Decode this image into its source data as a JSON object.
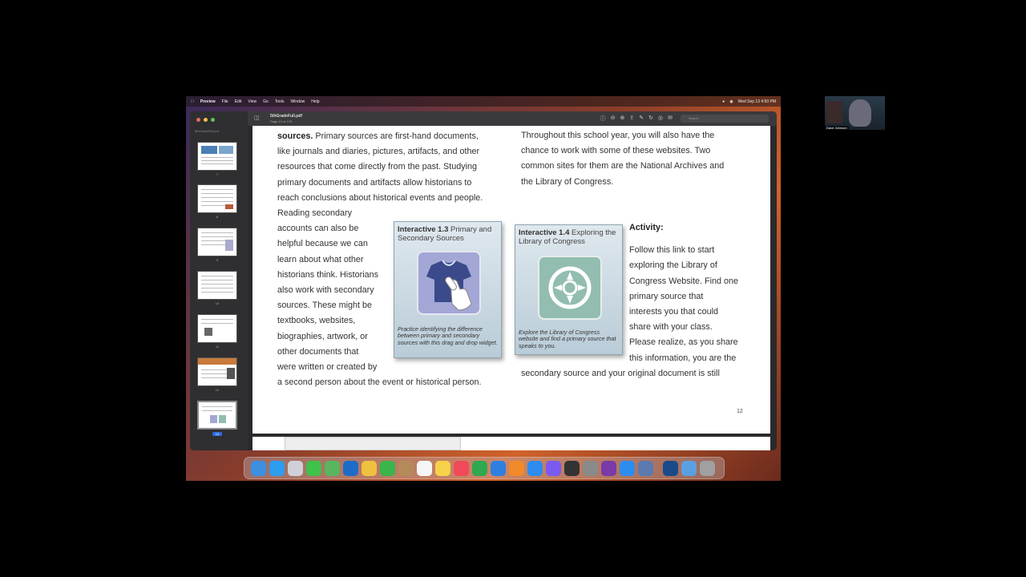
{
  "menubar": {
    "apple": "",
    "items": [
      "Preview",
      "File",
      "Edit",
      "View",
      "Go",
      "Tools",
      "Window",
      "Help"
    ],
    "clock": "Wed Sep 13  4:50 PM"
  },
  "sidebar": {
    "filename": "5thGradeFull.pdf",
    "thumbs": [
      "7",
      "8",
      "9",
      "10",
      "11",
      "12",
      "13"
    ]
  },
  "toolbar": {
    "doc_title": "5thGradeFull.pdf",
    "page_info": "Page 13 of 178",
    "search_placeholder": "Search"
  },
  "page": {
    "left_lines": [
      "sources.",
      "like journals and diaries,  pictures, artifacts, and other",
      "resources that come directly from the past.  Studying",
      "primary documents and artifacts allow historians to",
      "reach conclusions about historical events and people.",
      "Reading secondary",
      "accounts can also be",
      "helpful because we can",
      "learn about what other",
      "historians think.  Historians",
      "also work with secondary",
      "sources.  These might be",
      "textbooks, websites,",
      "biographies, artwork, or",
      "other  documents that",
      "were written or created by",
      "a second person about the event or historical person."
    ],
    "first_line_rest": "  Primary sources are first-hand documents,",
    "right_lines": [
      "Throughout this school year, you will also have the",
      "chance to work with some of these websites.  Two",
      "common sites for them are the National Archives and",
      "the Library of Congress."
    ],
    "activity_title": "Activity:",
    "activity_lines": [
      "Follow this link to start",
      "exploring the Library of",
      "Congress Website. Find one",
      "primary source that",
      "interests you that could",
      "share with your class.",
      " Please realize, as you share",
      "this information, you are the"
    ],
    "bottom_line": "secondary source and your original document is still",
    "page_number": "12",
    "card1": {
      "label": "Interactive 1.3",
      "title": " Primary and Secondary Sources",
      "desc": "Practice identifying the difference between primary and secondary sources with this drag and drop widget."
    },
    "card2": {
      "label": "Interactive 1.4",
      "title": " Exploring the Library of Congress",
      "desc": "Explore the Library of Congress website and find a primary source that speaks to you."
    }
  },
  "dock": {
    "icons": [
      "finder-icon",
      "safari-icon",
      "launchpad-icon",
      "messages-icon",
      "maps-icon",
      "outlook-icon",
      "photos-icon",
      "facetime-icon",
      "contacts-icon",
      "reminders-icon",
      "notes-icon",
      "music-icon",
      "numbers-icon",
      "keynote-icon",
      "pages-icon",
      "app-store-icon",
      "siri-icon",
      "claquette-icon",
      "system-settings-icon",
      "onenote-icon",
      "zoom-icon",
      "preview-icon",
      "pixelmator-icon",
      "folder-icon",
      "trash-icon"
    ],
    "colors": [
      "#3d8fe0",
      "#2d9df0",
      "#d0d0d8",
      "#3fc14a",
      "#5ab55e",
      "#1e6cc8",
      "#f0c040",
      "#39b54a",
      "#b48a5a",
      "#f5f5f5",
      "#f7d14a",
      "#f04a5a",
      "#2fa84f",
      "#2f7fe0",
      "#f08a2a",
      "#2d8cf0",
      "#7a5af0",
      "#333333",
      "#8a8a8a",
      "#7a3aa8",
      "#2d8cf0",
      "#5a7ab0",
      "#1a4a8a",
      "#5aa0e0",
      "#a0a0a0"
    ]
  },
  "webcam": {
    "name": "Dave Johnson"
  }
}
